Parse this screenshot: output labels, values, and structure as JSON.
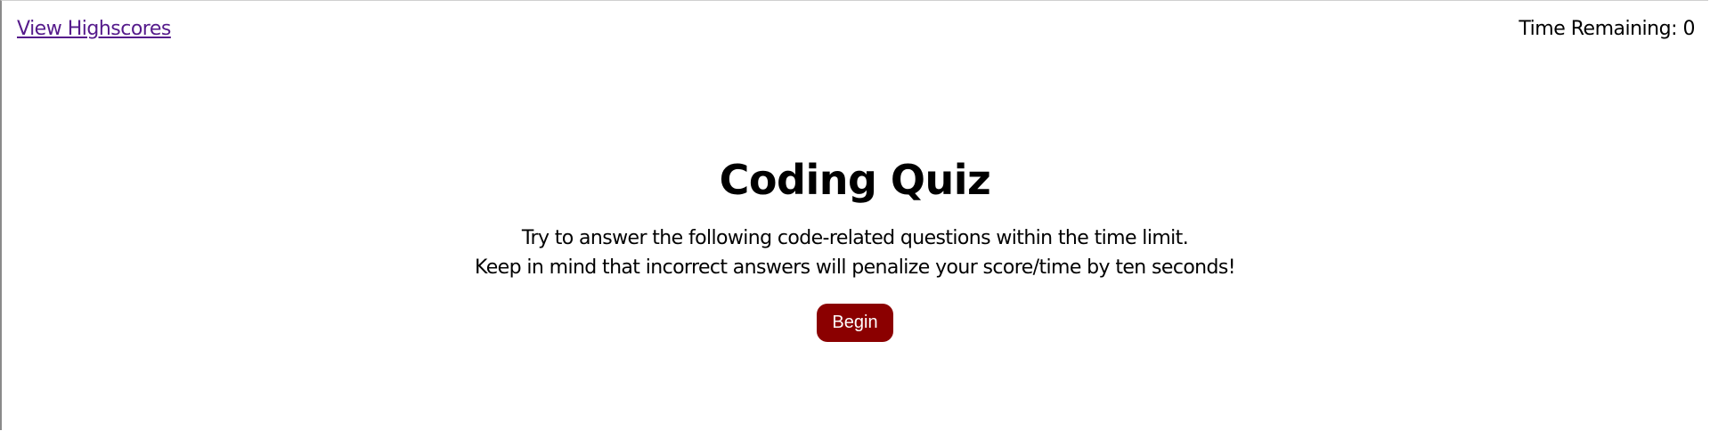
{
  "header": {
    "highscores_link": "View Highscores",
    "timer_label": "Time Remaining:",
    "timer_value": "0"
  },
  "intro": {
    "title": "Coding Quiz",
    "line1": "Try to answer the following code-related questions within the time limit.",
    "line2": "Keep in mind that incorrect answers will penalize your score/time by ten seconds!",
    "begin_label": "Begin"
  },
  "colors": {
    "link": "#551a8b",
    "button_bg": "#8b0000",
    "button_text": "#ffffff"
  }
}
